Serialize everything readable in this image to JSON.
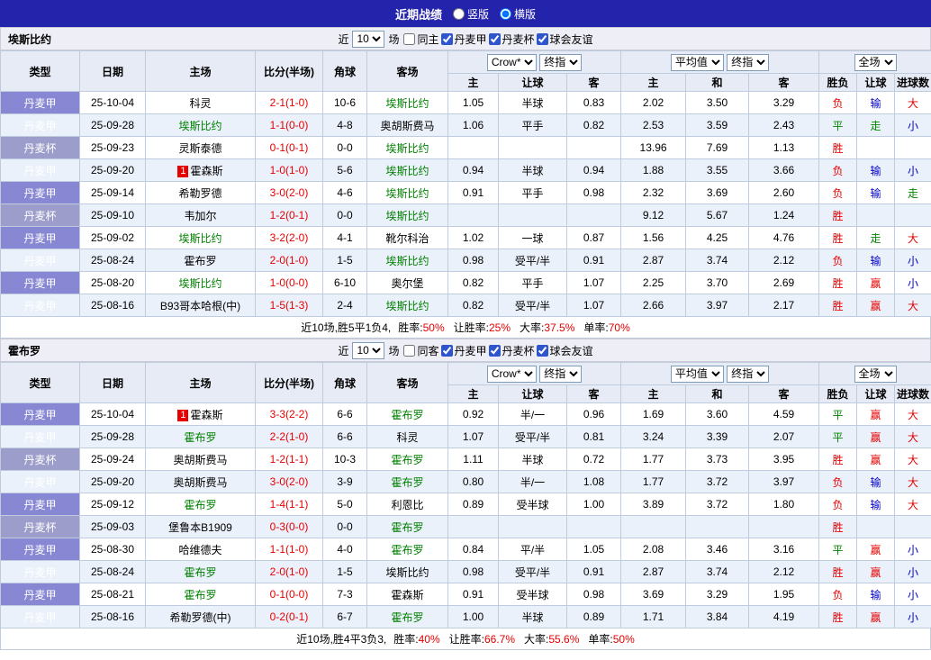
{
  "topbar": {
    "title": "近期战绩",
    "options": [
      {
        "label": "竖版",
        "selected": false
      },
      {
        "label": "横版",
        "selected": true
      }
    ]
  },
  "filters": {
    "near": "近",
    "count": "10",
    "games": "场"
  },
  "table_header": {
    "type": "类型",
    "date": "日期",
    "home": "主场",
    "score": "比分(半场)",
    "corner": "角球",
    "away": "客场",
    "group1": {
      "select1": "Crow*",
      "select2": "终指",
      "cols": [
        "主",
        "让球",
        "客"
      ]
    },
    "group2": {
      "select1": "平均值",
      "select2": "终指",
      "cols": [
        "主",
        "和",
        "客"
      ]
    },
    "group3": {
      "select1": "全场",
      "cols": [
        "胜负",
        "让球",
        "进球数"
      ]
    }
  },
  "colors": {
    "topbar": "#2323ab",
    "secbar": "#eeeef6",
    "headbg": "#e7ebf6",
    "alt": "#ebf1fa",
    "border": "#bfccde",
    "league": "#8787d4",
    "cup": "#9d9dcb",
    "red": "#e60000",
    "blue": "#0000cc",
    "green": "#008800",
    "self": "#008000"
  },
  "sections": [
    {
      "team": "埃斯比约",
      "checks": [
        {
          "label": "同主",
          "checked": false
        },
        {
          "label": "丹麦甲",
          "checked": true
        },
        {
          "label": "丹麦杯",
          "checked": true
        },
        {
          "label": "球会友谊",
          "checked": true
        }
      ],
      "rows": [
        {
          "league": "丹麦甲",
          "date": "25-10-04",
          "home": "科灵",
          "score": "2-1(1-0)",
          "corners": "10-6",
          "away": "埃斯比约",
          "away_self": true,
          "odds": [
            "1.05",
            "半球",
            "0.83"
          ],
          "avg": [
            "2.02",
            "3.50",
            "3.29"
          ],
          "results": [
            [
              "负",
              "red"
            ],
            [
              "输",
              "blue"
            ],
            [
              "大",
              "red"
            ]
          ]
        },
        {
          "league": "丹麦甲",
          "date": "25-09-28",
          "home": "埃斯比约",
          "home_self": true,
          "score": "1-1(0-0)",
          "corners": "4-8",
          "away": "奥胡斯费马",
          "odds": [
            "1.06",
            "平手",
            "0.82"
          ],
          "avg": [
            "2.53",
            "3.59",
            "2.43"
          ],
          "results": [
            [
              "平",
              "green"
            ],
            [
              "走",
              "green"
            ],
            [
              "小",
              "blue"
            ]
          ]
        },
        {
          "league": "丹麦杯",
          "cup": true,
          "date": "25-09-23",
          "home": "灵斯泰德",
          "score": "0-1(0-1)",
          "corners": "0-0",
          "away": "埃斯比约",
          "away_self": true,
          "odds": [
            "",
            "",
            ""
          ],
          "avg": [
            "13.96",
            "7.69",
            "1.13"
          ],
          "results": [
            [
              "胜",
              "red"
            ],
            [
              "",
              ""
            ],
            [
              "",
              ""
            ]
          ]
        },
        {
          "league": "丹麦甲",
          "date": "25-09-20",
          "home": "霍森斯",
          "badge": "1",
          "score": "1-0(1-0)",
          "corners": "5-6",
          "away": "埃斯比约",
          "away_self": true,
          "odds": [
            "0.94",
            "半球",
            "0.94"
          ],
          "avg": [
            "1.88",
            "3.55",
            "3.66"
          ],
          "results": [
            [
              "负",
              "red"
            ],
            [
              "输",
              "blue"
            ],
            [
              "小",
              "blue"
            ]
          ]
        },
        {
          "league": "丹麦甲",
          "date": "25-09-14",
          "home": "希勒罗德",
          "score": "3-0(2-0)",
          "corners": "4-6",
          "away": "埃斯比约",
          "away_self": true,
          "odds": [
            "0.91",
            "平手",
            "0.98"
          ],
          "avg": [
            "2.32",
            "3.69",
            "2.60"
          ],
          "results": [
            [
              "负",
              "red"
            ],
            [
              "输",
              "blue"
            ],
            [
              "走",
              "green"
            ]
          ]
        },
        {
          "league": "丹麦杯",
          "cup": true,
          "date": "25-09-10",
          "home": "韦加尔",
          "score": "1-2(0-1)",
          "corners": "0-0",
          "away": "埃斯比约",
          "away_self": true,
          "odds": [
            "",
            "",
            ""
          ],
          "avg": [
            "9.12",
            "5.67",
            "1.24"
          ],
          "results": [
            [
              "胜",
              "red"
            ],
            [
              "",
              ""
            ],
            [
              "",
              ""
            ]
          ]
        },
        {
          "league": "丹麦甲",
          "date": "25-09-02",
          "home": "埃斯比约",
          "home_self": true,
          "score": "3-2(2-0)",
          "corners": "4-1",
          "away": "靴尔科治",
          "odds": [
            "1.02",
            "一球",
            "0.87"
          ],
          "avg": [
            "1.56",
            "4.25",
            "4.76"
          ],
          "results": [
            [
              "胜",
              "red"
            ],
            [
              "走",
              "green"
            ],
            [
              "大",
              "red"
            ]
          ]
        },
        {
          "league": "丹麦甲",
          "date": "25-08-24",
          "home": "霍布罗",
          "score": "2-0(1-0)",
          "corners": "1-5",
          "away": "埃斯比约",
          "away_self": true,
          "odds": [
            "0.98",
            "受平/半",
            "0.91"
          ],
          "avg": [
            "2.87",
            "3.74",
            "2.12"
          ],
          "results": [
            [
              "负",
              "red"
            ],
            [
              "输",
              "blue"
            ],
            [
              "小",
              "blue"
            ]
          ]
        },
        {
          "league": "丹麦甲",
          "date": "25-08-20",
          "home": "埃斯比约",
          "home_self": true,
          "score": "1-0(0-0)",
          "corners": "6-10",
          "away": "奥尔堡",
          "odds": [
            "0.82",
            "平手",
            "1.07"
          ],
          "avg": [
            "2.25",
            "3.70",
            "2.69"
          ],
          "results": [
            [
              "胜",
              "red"
            ],
            [
              "赢",
              "red"
            ],
            [
              "小",
              "blue"
            ]
          ]
        },
        {
          "league": "丹麦甲",
          "date": "25-08-16",
          "home": "B93哥本哈根(中)",
          "score": "1-5(1-3)",
          "corners": "2-4",
          "away": "埃斯比约",
          "away_self": true,
          "odds": [
            "0.82",
            "受平/半",
            "1.07"
          ],
          "avg": [
            "2.66",
            "3.97",
            "2.17"
          ],
          "results": [
            [
              "胜",
              "red"
            ],
            [
              "赢",
              "red"
            ],
            [
              "大",
              "red"
            ]
          ]
        }
      ],
      "summary": {
        "prefix": "近10场,胜5平1负4,",
        "stats": [
          {
            "label": "胜率:",
            "value": "50%"
          },
          {
            "label": "让胜率:",
            "value": "25%"
          },
          {
            "label": "大率:",
            "value": "37.5%"
          },
          {
            "label": "单率:",
            "value": "70%"
          }
        ]
      }
    },
    {
      "team": "霍布罗",
      "checks": [
        {
          "label": "同客",
          "checked": false
        },
        {
          "label": "丹麦甲",
          "checked": true
        },
        {
          "label": "丹麦杯",
          "checked": true
        },
        {
          "label": "球会友谊",
          "checked": true
        }
      ],
      "rows": [
        {
          "league": "丹麦甲",
          "date": "25-10-04",
          "home": "霍森斯",
          "badge": "1",
          "score": "3-3(2-2)",
          "corners": "6-6",
          "away": "霍布罗",
          "away_self": true,
          "odds": [
            "0.92",
            "半/一",
            "0.96"
          ],
          "avg": [
            "1.69",
            "3.60",
            "4.59"
          ],
          "results": [
            [
              "平",
              "green"
            ],
            [
              "赢",
              "red"
            ],
            [
              "大",
              "red"
            ]
          ]
        },
        {
          "league": "丹麦甲",
          "date": "25-09-28",
          "home": "霍布罗",
          "home_self": true,
          "score": "2-2(1-0)",
          "corners": "6-6",
          "away": "科灵",
          "odds": [
            "1.07",
            "受平/半",
            "0.81"
          ],
          "avg": [
            "3.24",
            "3.39",
            "2.07"
          ],
          "results": [
            [
              "平",
              "green"
            ],
            [
              "赢",
              "red"
            ],
            [
              "大",
              "red"
            ]
          ]
        },
        {
          "league": "丹麦杯",
          "cup": true,
          "date": "25-09-24",
          "home": "奥胡斯费马",
          "score": "1-2(1-1)",
          "corners": "10-3",
          "away": "霍布罗",
          "away_self": true,
          "odds": [
            "1.11",
            "半球",
            "0.72"
          ],
          "avg": [
            "1.77",
            "3.73",
            "3.95"
          ],
          "results": [
            [
              "胜",
              "red"
            ],
            [
              "赢",
              "red"
            ],
            [
              "大",
              "red"
            ]
          ]
        },
        {
          "league": "丹麦甲",
          "date": "25-09-20",
          "home": "奥胡斯费马",
          "score": "3-0(2-0)",
          "corners": "3-9",
          "away": "霍布罗",
          "away_self": true,
          "odds": [
            "0.80",
            "半/一",
            "1.08"
          ],
          "avg": [
            "1.77",
            "3.72",
            "3.97"
          ],
          "results": [
            [
              "负",
              "red"
            ],
            [
              "输",
              "blue"
            ],
            [
              "大",
              "red"
            ]
          ]
        },
        {
          "league": "丹麦甲",
          "date": "25-09-12",
          "home": "霍布罗",
          "home_self": true,
          "score": "1-4(1-1)",
          "corners": "5-0",
          "away": "利恩比",
          "odds": [
            "0.89",
            "受半球",
            "1.00"
          ],
          "avg": [
            "3.89",
            "3.72",
            "1.80"
          ],
          "results": [
            [
              "负",
              "red"
            ],
            [
              "输",
              "blue"
            ],
            [
              "大",
              "red"
            ]
          ]
        },
        {
          "league": "丹麦杯",
          "cup": true,
          "date": "25-09-03",
          "home": "堡鲁本B1909",
          "score": "0-3(0-0)",
          "corners": "0-0",
          "away": "霍布罗",
          "away_self": true,
          "odds": [
            "",
            "",
            ""
          ],
          "avg": [
            "",
            "",
            ""
          ],
          "results": [
            [
              "胜",
              "red"
            ],
            [
              "",
              ""
            ],
            [
              "",
              ""
            ]
          ]
        },
        {
          "league": "丹麦甲",
          "date": "25-08-30",
          "home": "哈维德夫",
          "score": "1-1(1-0)",
          "corners": "4-0",
          "away": "霍布罗",
          "away_self": true,
          "odds": [
            "0.84",
            "平/半",
            "1.05"
          ],
          "avg": [
            "2.08",
            "3.46",
            "3.16"
          ],
          "results": [
            [
              "平",
              "green"
            ],
            [
              "赢",
              "red"
            ],
            [
              "小",
              "blue"
            ]
          ]
        },
        {
          "league": "丹麦甲",
          "date": "25-08-24",
          "home": "霍布罗",
          "home_self": true,
          "score": "2-0(1-0)",
          "corners": "1-5",
          "away": "埃斯比约",
          "odds": [
            "0.98",
            "受平/半",
            "0.91"
          ],
          "avg": [
            "2.87",
            "3.74",
            "2.12"
          ],
          "results": [
            [
              "胜",
              "red"
            ],
            [
              "赢",
              "red"
            ],
            [
              "小",
              "blue"
            ]
          ]
        },
        {
          "league": "丹麦甲",
          "date": "25-08-21",
          "home": "霍布罗",
          "home_self": true,
          "score": "0-1(0-0)",
          "corners": "7-3",
          "away": "霍森斯",
          "odds": [
            "0.91",
            "受半球",
            "0.98"
          ],
          "avg": [
            "3.69",
            "3.29",
            "1.95"
          ],
          "results": [
            [
              "负",
              "red"
            ],
            [
              "输",
              "blue"
            ],
            [
              "小",
              "blue"
            ]
          ]
        },
        {
          "league": "丹麦甲",
          "date": "25-08-16",
          "home": "希勒罗德(中)",
          "score": "0-2(0-1)",
          "corners": "6-7",
          "away": "霍布罗",
          "away_self": true,
          "odds": [
            "1.00",
            "半球",
            "0.89"
          ],
          "avg": [
            "1.71",
            "3.84",
            "4.19"
          ],
          "results": [
            [
              "胜",
              "red"
            ],
            [
              "赢",
              "red"
            ],
            [
              "小",
              "blue"
            ]
          ]
        }
      ],
      "summary": {
        "prefix": "近10场,胜4平3负3,",
        "stats": [
          {
            "label": "胜率:",
            "value": "40%"
          },
          {
            "label": "让胜率:",
            "value": "66.7%"
          },
          {
            "label": "大率:",
            "value": "55.6%"
          },
          {
            "label": "单率:",
            "value": "50%"
          }
        ]
      }
    }
  ]
}
